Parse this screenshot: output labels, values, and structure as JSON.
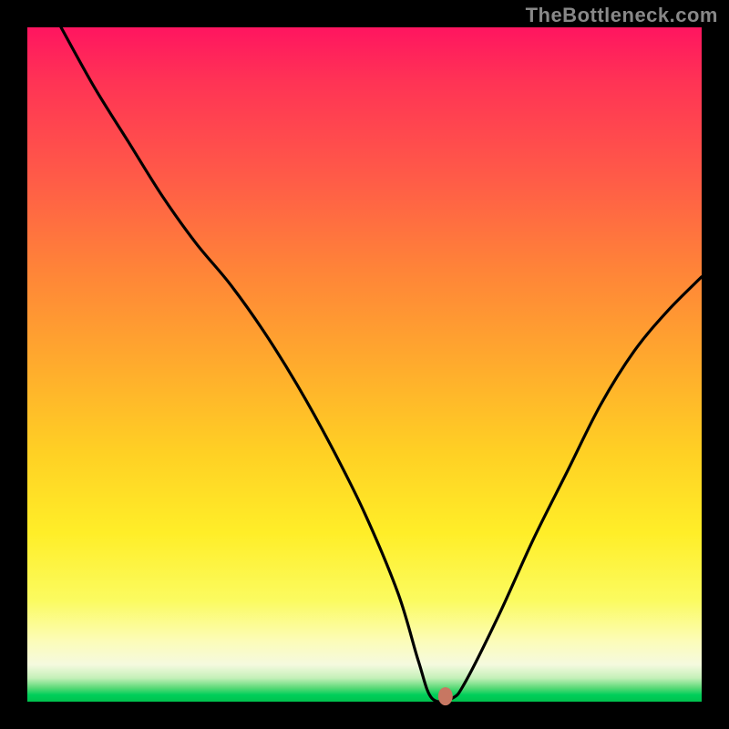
{
  "watermark": "TheBottleneck.com",
  "chart_data": {
    "type": "line",
    "title": "",
    "xlabel": "",
    "ylabel": "",
    "xlim": [
      0,
      100
    ],
    "ylim": [
      0,
      100
    ],
    "series": [
      {
        "name": "bottleneck-curve",
        "x": [
          5,
          10,
          15,
          20,
          25,
          30,
          35,
          40,
          45,
          50,
          55,
          58,
          60,
          63,
          65,
          70,
          75,
          80,
          85,
          90,
          95,
          100
        ],
        "values": [
          100,
          91,
          83,
          75,
          68,
          62,
          55,
          47,
          38,
          28,
          16,
          6,
          0.5,
          0.5,
          3,
          13,
          24,
          34,
          44,
          52,
          58,
          63
        ]
      }
    ],
    "annotations": [
      {
        "name": "optimum-marker",
        "x": 62,
        "y": 0.8
      }
    ],
    "background_gradient": {
      "axis": "y",
      "stops": [
        {
          "pos": 0,
          "color": "#00c24e"
        },
        {
          "pos": 4,
          "color": "#58d976"
        },
        {
          "pos": 8,
          "color": "#f5fadf"
        },
        {
          "pos": 14,
          "color": "#fcfcb8"
        },
        {
          "pos": 25,
          "color": "#ffee28"
        },
        {
          "pos": 50,
          "color": "#ffab2d"
        },
        {
          "pos": 78,
          "color": "#ff5a48"
        },
        {
          "pos": 100,
          "color": "#ff1560"
        }
      ]
    }
  }
}
